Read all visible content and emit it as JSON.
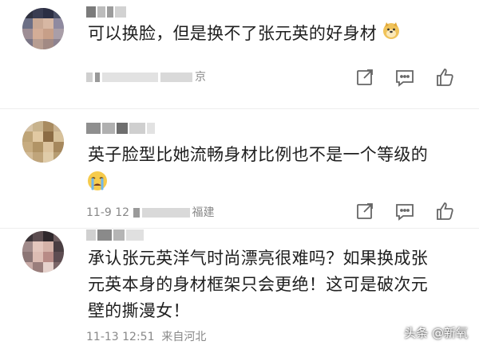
{
  "comments": [
    {
      "text_lines": [
        "可以换脸，但是换不了张元英的好身材"
      ],
      "location": "京",
      "emoji": "doge-emoji"
    },
    {
      "text_lines": [
        "英子脸型比她流畅身材比例也不是一个等级的"
      ],
      "timestamp": "11-9 12",
      "location": "福建",
      "emoji": "crying-emoji"
    },
    {
      "text_lines": [
        "承认张元英洋气时尚漂亮很难吗？如果换成张",
        "元英本身的身材框架只会更绝！这可是破次元",
        "壁的撕漫女！"
      ],
      "timestamp": "11-13 12:51",
      "location": "来自河北"
    }
  ],
  "icons": [
    "share-icon",
    "comment-icon",
    "like-icon"
  ],
  "watermark": "头条 @新氧"
}
